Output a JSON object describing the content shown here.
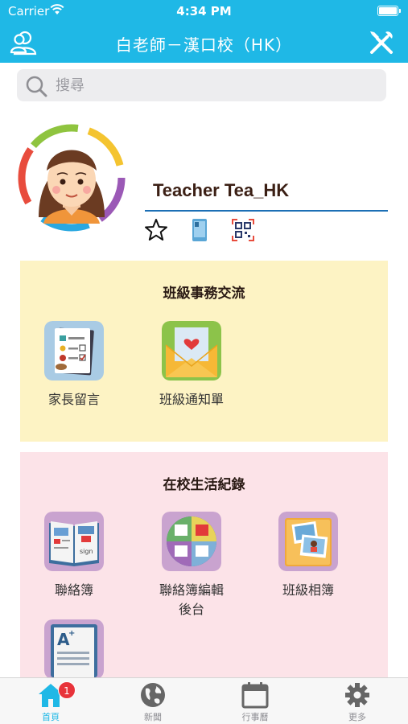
{
  "status_bar": {
    "carrier": "Carrier",
    "time": "4:34 PM"
  },
  "nav": {
    "title": "白老師－漢口校（HK）",
    "left_icon": "users-icon",
    "right_icon": "tools-icon"
  },
  "search": {
    "placeholder": "搜尋",
    "value": ""
  },
  "profile": {
    "name": "Teacher Tea_HK",
    "icons": [
      "star-icon",
      "phone-icon",
      "qr-code-icon"
    ]
  },
  "sections": [
    {
      "title": "班級事務交流",
      "items": [
        {
          "label": "家長留言",
          "icon": "parent-message-icon"
        },
        {
          "label": "班級通知單",
          "icon": "class-notice-icon"
        }
      ]
    },
    {
      "title": "在校生活紀錄",
      "items": [
        {
          "label": "聯絡簿",
          "icon": "contact-book-icon"
        },
        {
          "label": "聯絡簿編輯\n後台",
          "icon": "contact-book-admin-icon"
        },
        {
          "label": "班級相簿",
          "icon": "class-album-icon"
        },
        {
          "label": "",
          "icon": "grade-report-icon"
        }
      ]
    }
  ],
  "tabbar": {
    "items": [
      {
        "label": "首頁",
        "icon": "home-icon",
        "badge": "1",
        "active": true
      },
      {
        "label": "新聞",
        "icon": "globe-icon"
      },
      {
        "label": "行事曆",
        "icon": "calendar-icon"
      },
      {
        "label": "更多",
        "icon": "gear-icon"
      }
    ]
  },
  "colors": {
    "accent": "#1fb8e6",
    "section_yellow": "#fdf3c4",
    "section_pink": "#fce3e8",
    "badge": "#e8333a",
    "name_underline": "#1c6fb5"
  }
}
